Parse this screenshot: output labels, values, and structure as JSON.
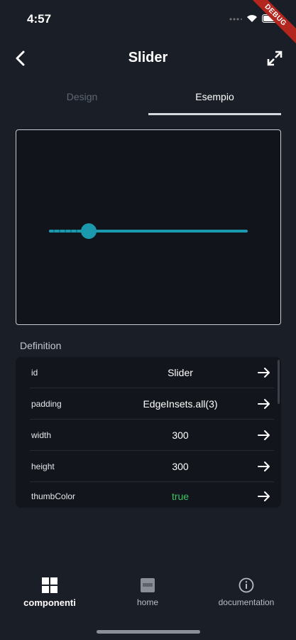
{
  "status": {
    "time": "4:57",
    "debug_label": "DEBUG"
  },
  "app_bar": {
    "title": "Slider"
  },
  "tabs": [
    {
      "label": "Design",
      "active": false
    },
    {
      "label": "Esempio",
      "active": true
    }
  ],
  "slider": {
    "value_fraction": 0.2,
    "color": "#1b99ad"
  },
  "definition": {
    "label": "Definition",
    "rows": [
      {
        "key": "id",
        "value": "Slider"
      },
      {
        "key": "padding",
        "value": "EdgeInsets.all(3)"
      },
      {
        "key": "width",
        "value": "300"
      },
      {
        "key": "height",
        "value": "300"
      },
      {
        "key": "thumbColor",
        "value": "true",
        "color": "#3fc463"
      }
    ]
  },
  "bottom_nav": [
    {
      "label": "componenti",
      "icon": "grid-icon",
      "active": true
    },
    {
      "label": "home",
      "icon": "dev-icon",
      "active": false
    },
    {
      "label": "documentation",
      "icon": "info-icon",
      "active": false
    }
  ]
}
